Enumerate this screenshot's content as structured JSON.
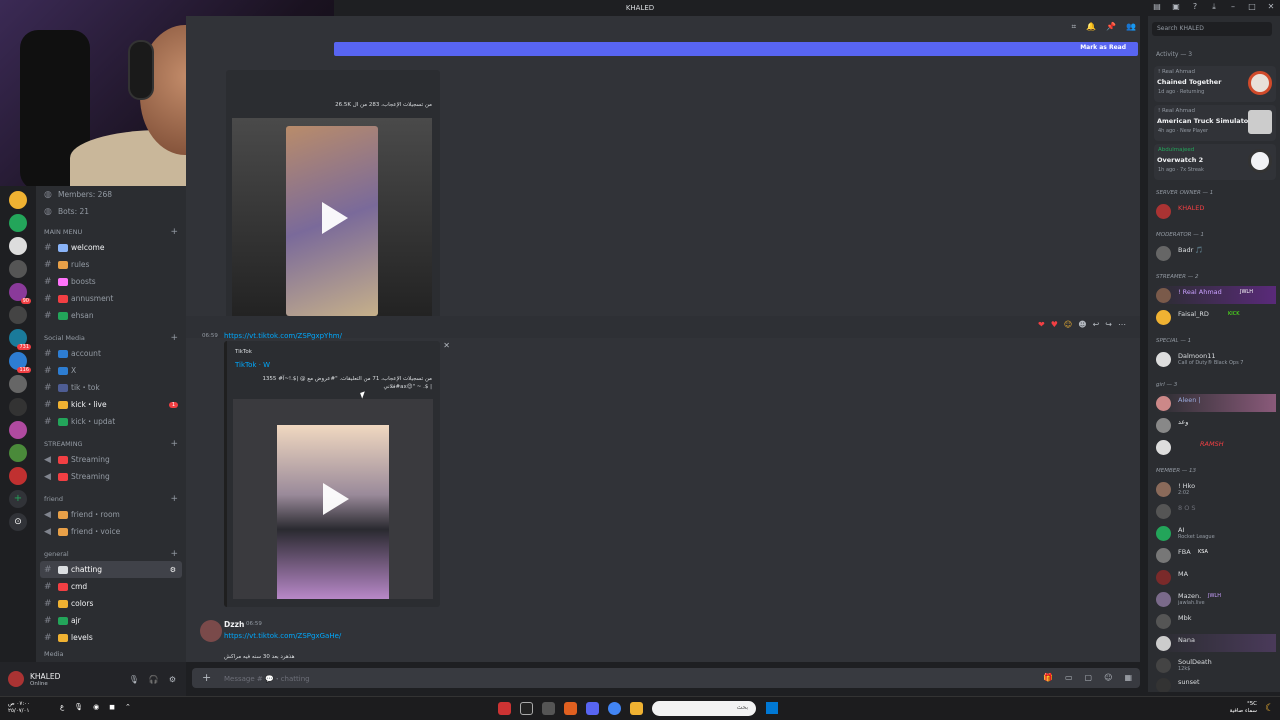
{
  "window": {
    "title": "KHALED"
  },
  "webcam": {
    "label": "streamer webcam"
  },
  "server_badges": [
    "",
    "",
    "",
    "",
    "90",
    "",
    "731",
    "116",
    "",
    "",
    "",
    "",
    ""
  ],
  "channels": {
    "members_label": "Members: 268",
    "bots_label": "Bots: 21",
    "main_menu": "MAIN MENU",
    "welcome": "welcome",
    "rules": "rules",
    "boosts": "boosts",
    "annusment": "annusment",
    "ehsan": "ehsan",
    "social_media": "Social Media",
    "account": "account",
    "x": "X",
    "tiktok": "tik・tok",
    "kick_live": "kick・live",
    "kick_live_badge": "1",
    "kick_updat": "kick・updat",
    "streaming_cat": "STREAMING",
    "streaming1": "Streaming",
    "streaming2": "Streaming",
    "friend_cat": "friend",
    "friend_room": "friend・room",
    "friend_voice": "friend・voice",
    "general_cat": "general",
    "chatting": "chatting",
    "cmd": "cmd",
    "colors": "colors",
    "ajr": "ajr",
    "levels": "levels",
    "media_cat": "Media"
  },
  "user": {
    "name": "KHALED",
    "status": "Online"
  },
  "main": {
    "new_bar_label": "Mark as Read",
    "embed1_text": "26.5K من تسجيلات الإعجاب، 283 من ال",
    "msg_time": "06:59",
    "link1": "https://vt.tiktok.com/ZSPgxpYhm/",
    "embed2_provider": "TikTok",
    "embed2_title": "TikTok · W",
    "embed2_desc": "1355 من تسجيلات الإعجاب، 71 من التعليقات. \"#عروض مع @ |$.!~آ# فلاني#ax😊\" ~ .$ |",
    "msg3_author": "Dzzh",
    "msg3_time": "06:59",
    "msg3_link": "https://vt.tiktok.com/ZSPgxGaHe/",
    "msg3_text": "هذهرد بعد 30 سنه فيه مراكش",
    "composer_placeholder": "Message # 💬・chatting"
  },
  "right": {
    "search_placeholder": "Search KHALED",
    "activity_title": "Activity — 3",
    "activities": [
      {
        "user": "! Real Ahmad",
        "game": "Chained Together",
        "status": "1d ago  · Returning"
      },
      {
        "user": "! Real Ahmad",
        "game": "American Truck Simulator",
        "status": "4h ago  · New Player"
      },
      {
        "user": "Abdulmajeed",
        "game": "Overwatch 2",
        "status": "1h ago  · 7x Streak"
      }
    ],
    "sec_owner": "SERVER OWNER — 1",
    "owner": "KHALED",
    "sec_mod": "MODERATOR — 1",
    "mod": "Badr 🎵",
    "sec_streamer": "STREAMER — 2",
    "streamer1": "! Real Ahmad",
    "streamer1_tag": "JWLH",
    "streamer2": "Faisal_RD",
    "streamer2_tag": "KICK",
    "sec_special": "SPECIAL — 1",
    "special1": "Dalmoon11",
    "special1_sub": "Call of Duty® Black Ops 7",
    "sec_girl": "girl — 3",
    "girl1": "Aleen |",
    "girl2": "وعد",
    "girl3": "RAMSH",
    "sec_member": "MEMBER — 13",
    "m1": "! Hko",
    "m1_sub": "2:02",
    "m2": "8 O S",
    "m3": "AI",
    "m3_sub": "Rocket League",
    "m4": "FBA",
    "m4_tag": "KSA",
    "m5": "MA",
    "m6": "Mazen.",
    "m6_tag": "JWLH",
    "m6_sub": "jawlah.live",
    "m7": "Mbk",
    "m8": "Nana",
    "m9": "SoulDeath",
    "m9_sub": "12k$",
    "m10": "sunset"
  },
  "taskbar": {
    "time": "٠٧:٠٠ ص",
    "date": "٢٥/٠٧/٠١",
    "lang": "ع",
    "search_placeholder": "بحث",
    "weather_temp": "°5C",
    "weather_desc": "سماء صافية"
  },
  "colors": {
    "accent": "#5865f2",
    "link": "#00a8fc",
    "danger": "#f23f43",
    "online": "#23a55a"
  }
}
